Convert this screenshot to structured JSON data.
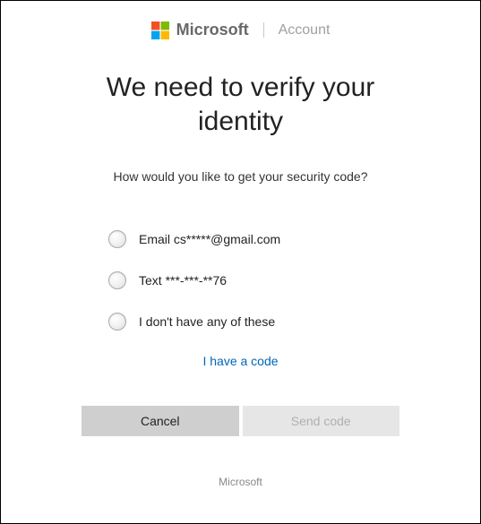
{
  "header": {
    "brand": "Microsoft",
    "subbrand": "Account"
  },
  "title": "We need to verify your identity",
  "subtitle": "How would you like to get your security code?",
  "options": [
    {
      "label": "Email cs*****@gmail.com"
    },
    {
      "label": "Text ***-***-**76"
    },
    {
      "label": "I don't have any of these"
    }
  ],
  "link_text": "I have a code",
  "buttons": {
    "cancel": "Cancel",
    "send": "Send code"
  },
  "footer": "Microsoft"
}
